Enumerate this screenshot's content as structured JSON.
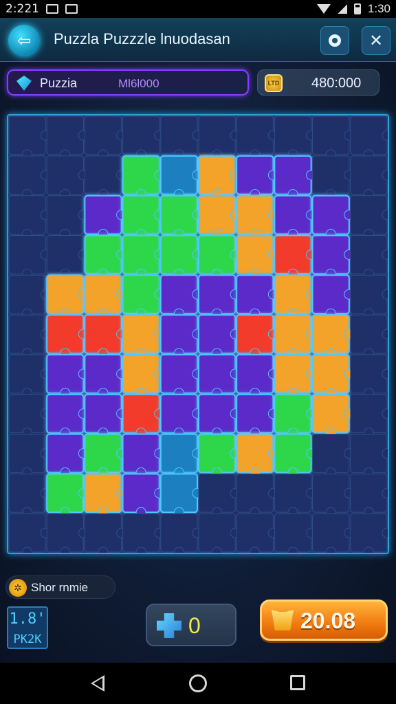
{
  "status_bar": {
    "time_left": "2:221",
    "time_right": "1:30"
  },
  "header": {
    "title": "Puzzla Puzzzle lnuodasan"
  },
  "level": {
    "name": "Puzzia",
    "score": "Ml6l000"
  },
  "coins": {
    "badge": "LTD",
    "value": "480:000"
  },
  "board": {
    "cols": 10,
    "rows": 11,
    "colors": {
      "base": "#1f2f68",
      "purple": "#5b2bc8",
      "green": "#2fd64a",
      "orange": "#f3a22a",
      "red": "#f23a2a",
      "teal": "#1a7fc0",
      "glow": "#4fc8ff"
    },
    "grid": [
      [
        "base",
        "base",
        "base",
        "base",
        "base",
        "base",
        "base",
        "base",
        "base",
        "base"
      ],
      [
        "base",
        "base",
        "base",
        "green",
        "teal",
        "orange",
        "purple",
        "purple",
        "base",
        "base"
      ],
      [
        "base",
        "base",
        "purple",
        "green",
        "green",
        "orange",
        "orange",
        "purple",
        "purple",
        "base"
      ],
      [
        "base",
        "base",
        "green",
        "green",
        "green",
        "green",
        "orange",
        "red",
        "purple",
        "base"
      ],
      [
        "base",
        "orange",
        "orange",
        "green",
        "purple",
        "purple",
        "purple",
        "orange",
        "purple",
        "base"
      ],
      [
        "base",
        "red",
        "red",
        "orange",
        "purple",
        "purple",
        "red",
        "orange",
        "orange",
        "base"
      ],
      [
        "base",
        "purple",
        "purple",
        "orange",
        "purple",
        "purple",
        "purple",
        "orange",
        "orange",
        "base"
      ],
      [
        "base",
        "purple",
        "purple",
        "red",
        "purple",
        "purple",
        "purple",
        "green",
        "orange",
        "base"
      ],
      [
        "base",
        "purple",
        "green",
        "purple",
        "teal",
        "green",
        "orange",
        "green",
        "base",
        "base"
      ],
      [
        "base",
        "green",
        "orange",
        "purple",
        "teal",
        "base",
        "base",
        "base",
        "base",
        "base"
      ],
      [
        "base",
        "base",
        "base",
        "base",
        "base",
        "base",
        "base",
        "base",
        "base",
        "base"
      ]
    ]
  },
  "hint": {
    "label": "Shor rnmie"
  },
  "stat": {
    "top": "1.8'",
    "bottom": "PK2K"
  },
  "hint_count": {
    "value": "0"
  },
  "buy": {
    "label": "20.08"
  },
  "icons": {
    "back": "back-arrow-icon",
    "settings": "settings-icon",
    "close": "close-icon",
    "gem": "gem-icon",
    "coin": "coin-icon",
    "puzzle": "puzzle-piece-icon",
    "crown": "crown-icon"
  }
}
